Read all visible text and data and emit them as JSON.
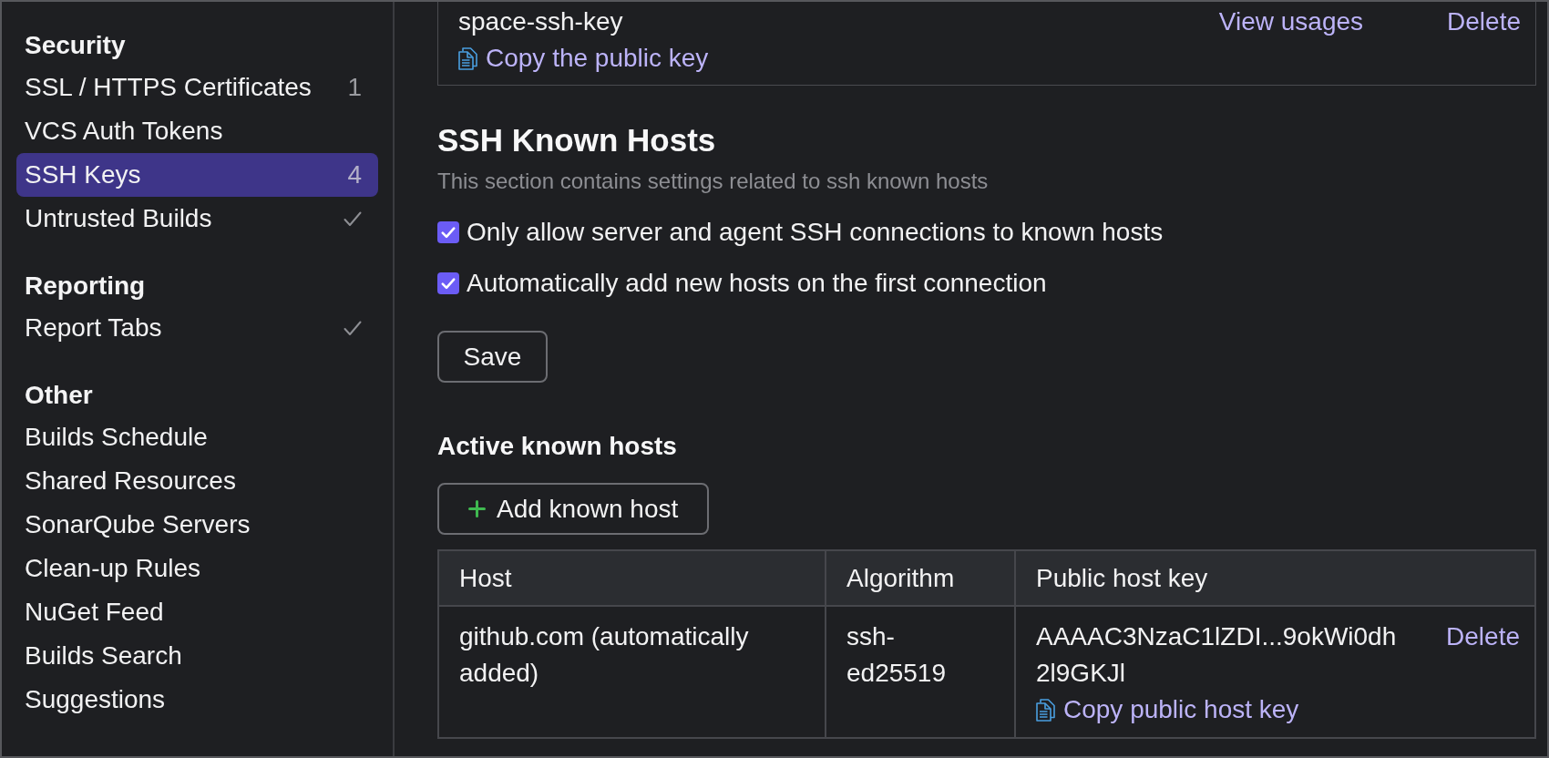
{
  "sidebar": {
    "groups": [
      {
        "title": "Security",
        "items": [
          {
            "label": "SSL / HTTPS Certificates",
            "count": "1",
            "configured": false,
            "selected": false
          },
          {
            "label": "VCS Auth Tokens",
            "configured": false,
            "selected": false
          },
          {
            "label": "SSH Keys",
            "count": "4",
            "configured": false,
            "selected": true
          },
          {
            "label": "Untrusted Builds",
            "configured": true,
            "selected": false
          }
        ]
      },
      {
        "title": "Reporting",
        "items": [
          {
            "label": "Report Tabs",
            "configured": true,
            "selected": false
          }
        ]
      },
      {
        "title": "Other",
        "items": [
          {
            "label": "Builds Schedule",
            "configured": false,
            "selected": false
          },
          {
            "label": "Shared Resources",
            "configured": false,
            "selected": false
          },
          {
            "label": "SonarQube Servers",
            "configured": false,
            "selected": false
          },
          {
            "label": "Clean-up Rules",
            "configured": false,
            "selected": false
          },
          {
            "label": "NuGet Feed",
            "configured": false,
            "selected": false
          },
          {
            "label": "Builds Search",
            "configured": false,
            "selected": false
          },
          {
            "label": "Suggestions",
            "configured": false,
            "selected": false
          }
        ]
      }
    ]
  },
  "ssh_key_card": {
    "name": "space-ssh-key",
    "actions": [
      "View usages",
      "Delete"
    ],
    "copy_link": "Copy the public key"
  },
  "known_hosts": {
    "title": "SSH Known Hosts",
    "description": "This section contains settings related to ssh known hosts",
    "options": [
      {
        "label": "Only allow server and agent SSH connections to known hosts",
        "checked": true
      },
      {
        "label": "Automatically add new hosts on the first connection",
        "checked": true
      }
    ],
    "save_button": "Save",
    "active_title": "Active known hosts",
    "add_button": "Add known host",
    "table": {
      "columns": [
        "Host",
        "Algorithm",
        "Public host key"
      ],
      "rows": [
        {
          "host": "github.com (automatically added)",
          "algorithm": "ssh-ed25519",
          "public_key": "AAAAC3NzaC1lZDI...9okWi0dh2l9GKJl",
          "delete": "Delete",
          "copy_link": "Copy public host key"
        }
      ]
    }
  }
}
